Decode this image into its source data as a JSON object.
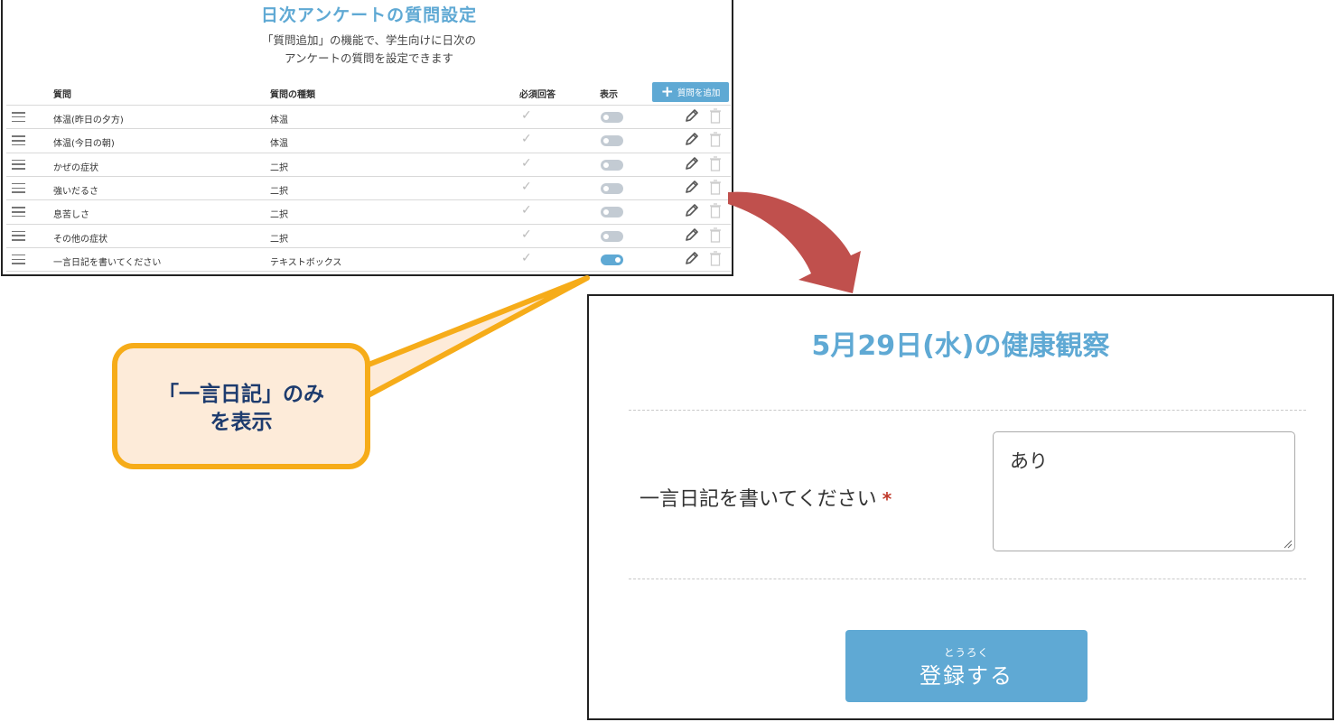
{
  "settings_panel": {
    "title": "日次アンケートの質問設定",
    "description_line1": "「質問追加」の機能で、学生向けに日次の",
    "description_line2": "アンケートの質問を設定できます",
    "columns": {
      "question": "質問",
      "type": "質問の種類",
      "required": "必須回答",
      "display": "表示"
    },
    "add_button_label": "質問を追加",
    "rows": [
      {
        "question": "体温(昨日の夕方)",
        "type": "体温",
        "required": true,
        "display": false
      },
      {
        "question": "体温(今日の朝)",
        "type": "体温",
        "required": true,
        "display": false
      },
      {
        "question": "かぜの症状",
        "type": "二択",
        "required": true,
        "display": false
      },
      {
        "question": "強いだるさ",
        "type": "二択",
        "required": true,
        "display": false
      },
      {
        "question": "息苦しさ",
        "type": "二択",
        "required": true,
        "display": false
      },
      {
        "question": "その他の症状",
        "type": "二択",
        "required": true,
        "display": false
      },
      {
        "question": "一言日記を書いてください",
        "type": "テキストボックス",
        "required": true,
        "display": true
      }
    ]
  },
  "callout": {
    "line1": "「一言日記」のみ",
    "line2": "を表示"
  },
  "form_panel": {
    "title": "5月29日(水)の健康観察",
    "question_label": "一言日記を書いてください",
    "required_mark": "*",
    "answer_value": "あり",
    "submit_ruby": "とうろく",
    "submit_label": "登録する"
  },
  "colors": {
    "accent": "#5fa9d4",
    "callout_border": "#f6ac19",
    "callout_fill": "#fdebd9",
    "callout_text": "#1d3b6e",
    "arrow": "#c0504d"
  },
  "icons": [
    "hamburger-icon",
    "check-icon",
    "toggle-switch",
    "pencil-icon",
    "trash-icon",
    "plus-icon",
    "resize-grip-icon"
  ]
}
